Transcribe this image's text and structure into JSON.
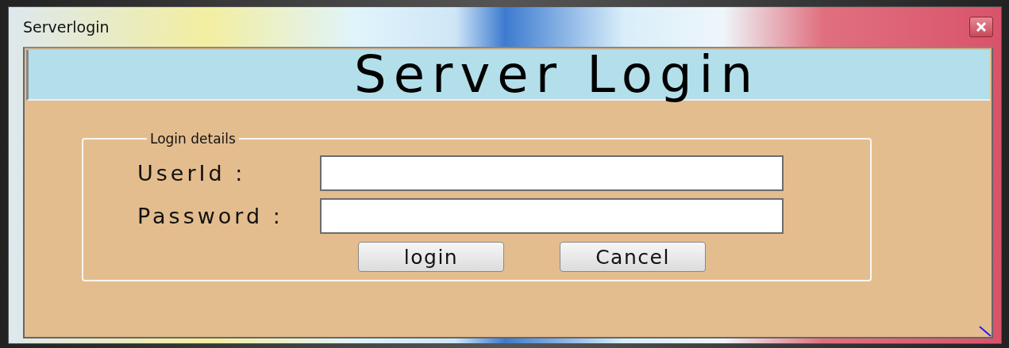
{
  "window": {
    "title": "Serverlogin"
  },
  "header": {
    "title": "Server Login"
  },
  "group": {
    "legend": "Login details",
    "fields": [
      {
        "label": "UserId :"
      },
      {
        "label": "Password :"
      }
    ],
    "buttons": [
      "login",
      "Cancel"
    ]
  }
}
